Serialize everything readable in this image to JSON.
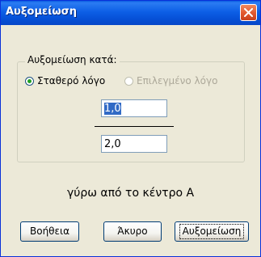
{
  "window": {
    "title": "Αυξομείωση"
  },
  "group": {
    "legend": "Αυξομείωση κατά:"
  },
  "options": {
    "fixed_ratio": {
      "label": "Σταθερό λόγο",
      "checked": true,
      "enabled": true
    },
    "selected_ratio": {
      "label": "Επιλεγμένο λόγο",
      "checked": false,
      "enabled": false
    }
  },
  "ratio": {
    "numerator": "1,0",
    "denominator": "2,0"
  },
  "center_text": "γύρω από το κέντρο Α",
  "buttons": {
    "help": "Βοήθεια",
    "cancel": "Άκυρο",
    "ok": "Αυξομείωση"
  },
  "colors": {
    "titlebar": "#0a5be0",
    "close_button": "#e2582e",
    "dialog_bg": "#ece9d8",
    "selection": "#316ac5",
    "radio_check": "#21a121"
  },
  "icons": {
    "close": "close-x-icon"
  }
}
